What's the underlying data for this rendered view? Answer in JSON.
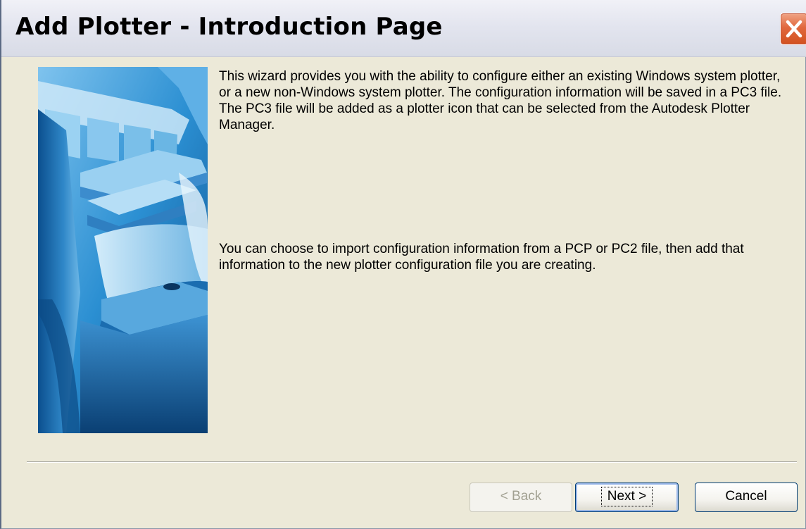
{
  "window": {
    "title": "Add Plotter - Introduction Page"
  },
  "intro": {
    "paragraph_1": "This wizard provides you with the ability to configure either an existing Windows system plotter, or a new non-Windows system plotter. The configuration information will be saved in a PC3 file. The PC3 file will be added as a plotter icon that can be selected from the Autodesk Plotter Manager.",
    "paragraph_2": "You can choose to import configuration information from a PCP or PC2 file, then add that information to the new plotter configuration file you are creating."
  },
  "buttons": {
    "back_label": "< Back",
    "next_label": "Next >",
    "cancel_label": "Cancel",
    "back_enabled": false
  },
  "icons": {
    "close": "close-icon",
    "illustration": "plotter-illustration"
  },
  "colors": {
    "dialog_bg": "#ece9d8",
    "close_red": "#e1683e",
    "illustration_blue": "#1e86c8"
  }
}
